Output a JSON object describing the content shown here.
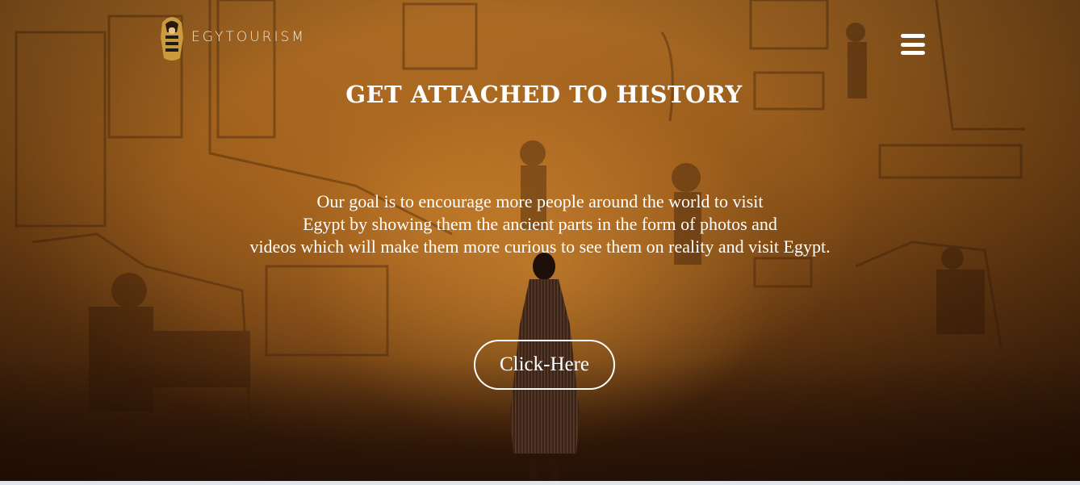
{
  "header": {
    "logo_text": "EGYTOURISM",
    "logo_icon": "sarcophagus-icon",
    "menu_icon": "hamburger-menu-icon"
  },
  "hero": {
    "headline": "GET ATTACHED TO HISTORY",
    "description_lines": [
      "Our goal is to encourage more people around the world to visit",
      "Egypt by showing them the ancient parts in the form of photos and",
      "videos which will make them more curious to see them on reality and visit Egypt."
    ],
    "cta_label": "Click-Here"
  },
  "colors": {
    "text": "#ffffff",
    "background_tone": "#8a5218"
  }
}
